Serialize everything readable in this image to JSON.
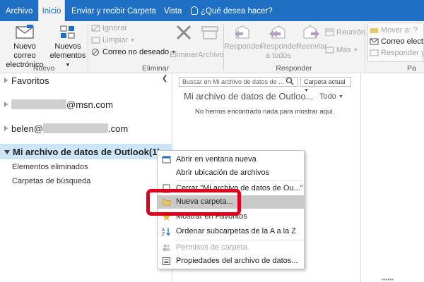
{
  "menubar": {
    "tabs": [
      "Archivo",
      "Inicio",
      "Enviar y recibir",
      "Carpeta",
      "Vista"
    ],
    "tell_me": "¿Qué desea hacer?",
    "colors": {
      "bar": "#1f6fc5",
      "active_tab": "#f3f3f3"
    }
  },
  "ribbon": {
    "nuevo": {
      "new_mail": [
        "Nuevo correo",
        "electrónico"
      ],
      "new_items": [
        "Nuevos",
        "elementos"
      ],
      "label": "Nuevo"
    },
    "eliminar": {
      "ignore": "Ignorar",
      "clean": "Limpiar",
      "junk": "Correo no deseado",
      "delete": "Eliminar",
      "archive": "Archivo",
      "label": "Eliminar"
    },
    "responder": {
      "reply": "Responder",
      "reply_all": [
        "Responder",
        "a todos"
      ],
      "forward": "Reenviar",
      "meeting": "Reunión",
      "more": "Más",
      "label": "Responder"
    },
    "mover": {
      "move_to": "Mover a: ?",
      "to_email": "Correo electró",
      "reply_delete": "Responder y e",
      "label": "Pa"
    }
  },
  "nav": {
    "favorites": "Favoritos",
    "account1_suffix": "@msn.com",
    "account2_prefix": "belen@",
    "account2_suffix": ".com",
    "datafile": "Mi archivo de datos de Outlook(1)",
    "sub1": "Elementos eliminados",
    "sub2": "Carpetas de búsqueda",
    "selected_color": "#cde6f7"
  },
  "content": {
    "search_placeholder": "Buscar en Mi archivo de datos de ...",
    "scope": "Carpeta actual",
    "title": "Mi archivo de datos de Outloo...",
    "filter": "Todo",
    "empty": "No hemos encontrado nada para mostrar aquí."
  },
  "context_menu": {
    "items": [
      {
        "label": "Abrir en ventana nueva",
        "enabled": true
      },
      {
        "label": "Abrir ubicación de archivos",
        "enabled": true
      },
      {
        "label": "Cerrar \"Mi archivo de datos de Ou...\"",
        "enabled": true
      },
      {
        "label": "Nueva carpeta...",
        "enabled": true,
        "highlighted": true
      },
      {
        "label": "Mostrar en Favoritos",
        "enabled": true
      },
      {
        "label": "Ordenar subcarpetas de la A a la Z",
        "enabled": true
      },
      {
        "label": "Permisos de carpeta",
        "enabled": false
      },
      {
        "label": "Propiedades del archivo de datos...",
        "enabled": true
      }
    ],
    "highlight_color": "#c9c9c9",
    "callout_color": "#e0001b"
  },
  "footer_fragment": "▪▪▪▪▪▪"
}
